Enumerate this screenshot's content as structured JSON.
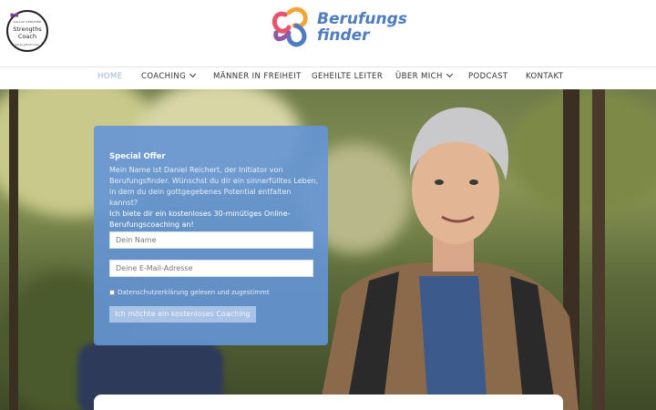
{
  "header": {
    "badge": {
      "top_text": "GALLUP CERTIFIED",
      "main": "Strengths Coach",
      "bottom_text": "StrengthsFinder"
    },
    "logo": {
      "line1": "Berufungs",
      "line2": "finder"
    }
  },
  "nav": {
    "items": [
      {
        "label": "HOME",
        "active": true
      },
      {
        "label": "COACHING",
        "dropdown": true
      },
      {
        "label": "MÄNNER IN FREIHEIT"
      },
      {
        "label": "GEHEILTE LEITER"
      },
      {
        "label": "ÜBER MICH",
        "dropdown": true
      },
      {
        "label": "PODCAST"
      },
      {
        "label": "KONTAKT"
      }
    ]
  },
  "form": {
    "title": "Special Offer",
    "intro": "Mein Name ist Daniel Reichert, der Initiator von Berufungsfinder. Wünschst du dir ein sinnerfülltes Leben, in dem du dein gottgegebenes Potential entfalten kannst?",
    "offer": "Ich biete dir ein kostenloses 30-minütiges Online-Berufungscoaching an!",
    "name_placeholder": "Dein Name",
    "email_placeholder": "Deine E-Mail-Adresse",
    "consent_label": "Datenschutzerklärung gelesen und zugestimmt",
    "submit_label": "Ich möchte ein kostenloses Coaching"
  },
  "colors": {
    "accent": "#4f7cc0",
    "card_bg": "#6495d6",
    "nav_active": "#9bb4d6"
  }
}
